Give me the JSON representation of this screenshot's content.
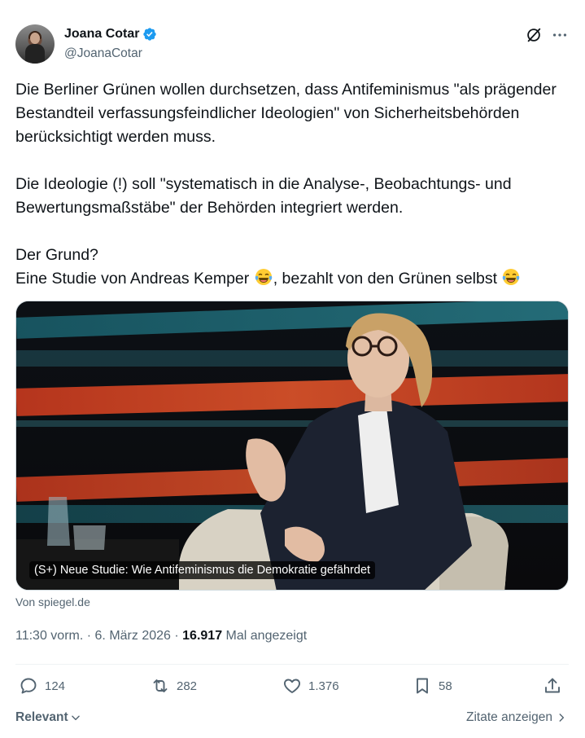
{
  "author": {
    "name": "Joana Cotar",
    "handle": "@JoanaCotar",
    "verified": true
  },
  "tweet": {
    "paragraph1": "Die Berliner Grünen wollen durchsetzen, dass Antifeminismus \"als prägender Bestandteil verfassungsfeindlicher Ideologien\" von Sicherheitsbehörden berücksichtigt werden muss.",
    "paragraph2": "Die Ideologie (!) soll \"systematisch in die Analyse-, Beobachtungs- und Bewertungsmaßstäbe\" der Behörden integriert werden.",
    "line_question": "Der Grund?",
    "line_study_a": "Eine Studie von Andreas Kemper ",
    "line_study_b": ", bezahlt von den Grünen selbst ",
    "emoji": "face-with-tears-of-joy"
  },
  "card": {
    "caption": "(S+) Neue Studie: Wie Antifeminismus die Demokratie gefährdet",
    "source": "Von spiegel.de"
  },
  "meta": {
    "time": "11:30 vorm.",
    "date": "6. März 2026",
    "views": "16.917",
    "views_label": "Mal angezeigt",
    "separator": "·"
  },
  "actions": {
    "replies": "124",
    "reposts": "282",
    "likes": "1.376",
    "bookmarks": "58"
  },
  "footer": {
    "sort_label": "Relevant",
    "quotes_label": "Zitate anzeigen"
  },
  "colors": {
    "accent": "#1d9bf0",
    "secondary_text": "#536471",
    "primary_text": "#0f1419"
  }
}
